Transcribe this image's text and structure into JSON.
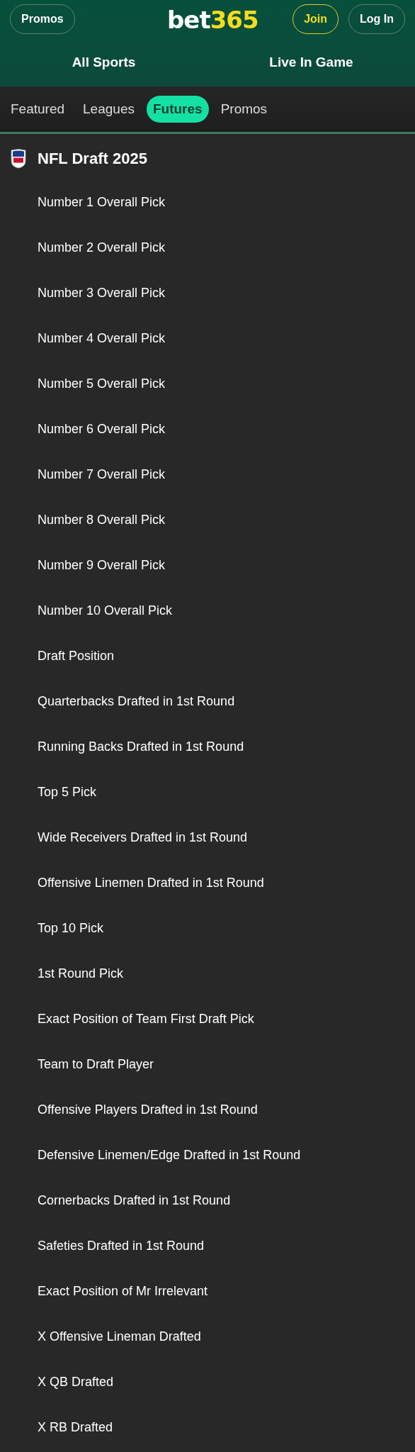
{
  "header": {
    "promos_button": "Promos",
    "logo": [
      {
        "text": "bet",
        "kind": "plain"
      },
      {
        "text": "365",
        "kind": "accent"
      }
    ],
    "join_button": "Join",
    "login_button": "Log In"
  },
  "nav": [
    "All Sports",
    "Live In Game"
  ],
  "tabs": [
    {
      "label": "Featured",
      "selected": false
    },
    {
      "label": "Leagues",
      "selected": false
    },
    {
      "label": "Futures",
      "selected": true
    },
    {
      "label": "Promos",
      "selected": false
    }
  ],
  "section": {
    "title": "NFL Draft 2025",
    "items": [
      "Number 1 Overall Pick",
      "Number 2 Overall Pick",
      "Number 3 Overall Pick",
      "Number 4 Overall Pick",
      "Number 5 Overall Pick",
      "Number 6 Overall Pick",
      "Number 7 Overall Pick",
      "Number 8 Overall Pick",
      "Number 9 Overall Pick",
      "Number 10 Overall Pick",
      "Draft Position",
      "Quarterbacks Drafted in 1st Round",
      "Running Backs Drafted in 1st Round",
      "Top 5 Pick",
      "Wide Receivers Drafted in 1st Round",
      "Offensive Linemen Drafted in 1st Round",
      "Top 10 Pick",
      "1st Round Pick",
      "Exact Position of Team First Draft Pick",
      "Team to Draft Player",
      "Offensive Players Drafted in 1st Round",
      "Defensive Linemen/Edge Drafted in 1st Round",
      "Cornerbacks Drafted in 1st Round",
      "Safeties Drafted in 1st Round",
      "Exact Position of Mr Irrelevant",
      "X Offensive Lineman Drafted",
      "X QB Drafted",
      "X RB Drafted"
    ]
  }
}
